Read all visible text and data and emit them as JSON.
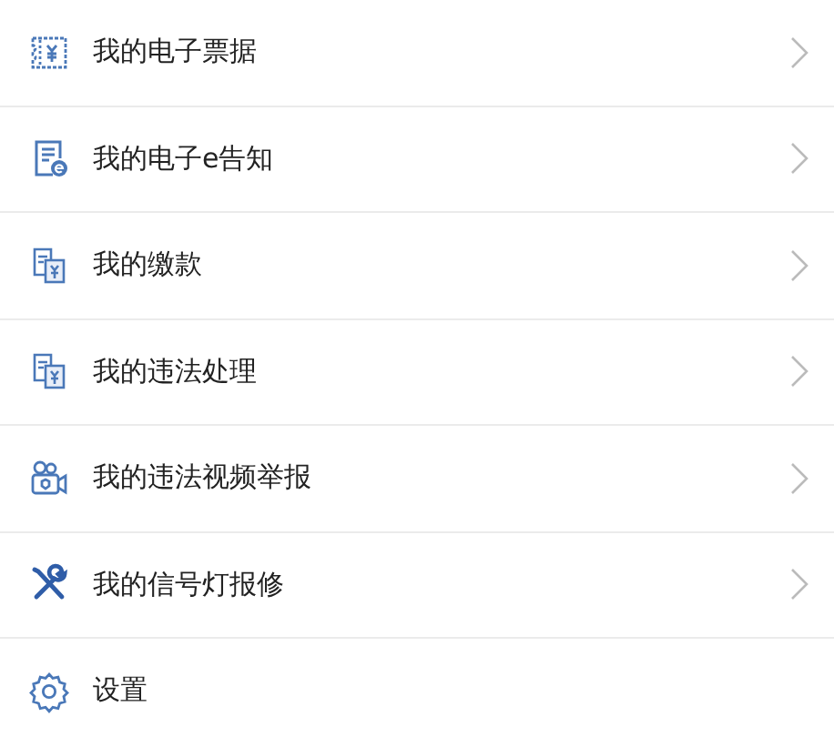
{
  "menu": [
    {
      "label": "我的电子票据",
      "kind": "ticket",
      "chevron": true
    },
    {
      "label": "我的电子e告知",
      "kind": "notice",
      "chevron": true
    },
    {
      "label": "我的缴款",
      "kind": "bill",
      "chevron": true
    },
    {
      "label": "我的违法处理",
      "kind": "bill",
      "chevron": true
    },
    {
      "label": "我的违法视频举报",
      "kind": "camera",
      "chevron": true
    },
    {
      "label": "我的信号灯报修",
      "kind": "tools",
      "chevron": true
    },
    {
      "label": "设置",
      "kind": "gear",
      "chevron": false
    }
  ]
}
